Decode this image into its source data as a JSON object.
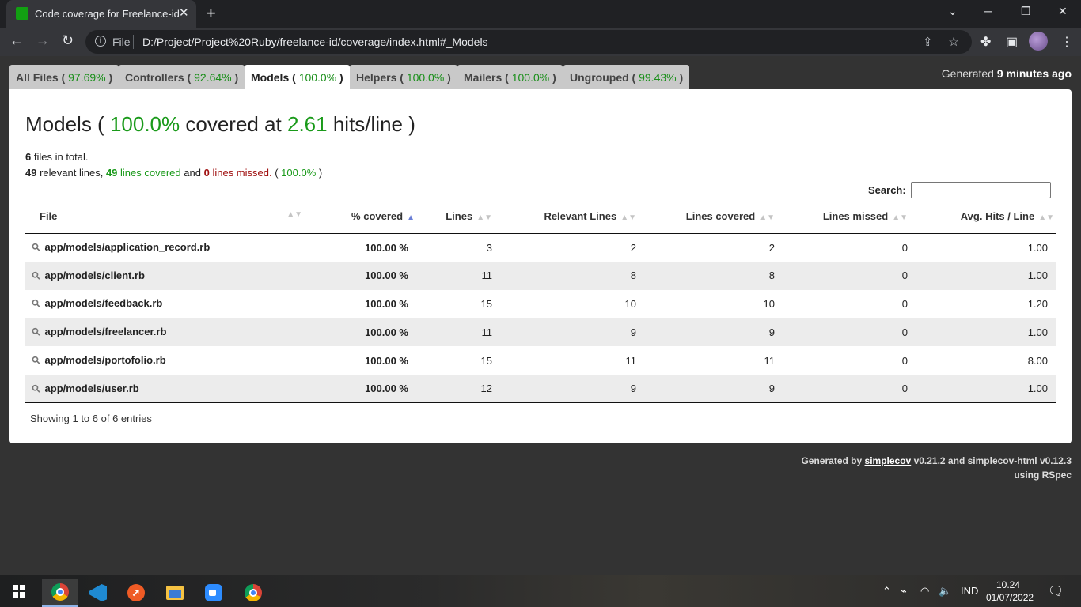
{
  "browser": {
    "tab_title": "Code coverage for Freelance-id",
    "new_tab": "+",
    "url_scheme": "File",
    "url": "D:/Project/Project%20Ruby/freelance-id/coverage/index.html#_Models"
  },
  "coverage_tabs": [
    {
      "name": "All Files",
      "pct": "97.69%"
    },
    {
      "name": "Controllers",
      "pct": "92.64%"
    },
    {
      "name": "Models",
      "pct": "100.0%"
    },
    {
      "name": "Helpers",
      "pct": "100.0%"
    },
    {
      "name": "Mailers",
      "pct": "100.0%"
    },
    {
      "name": "Ungrouped",
      "pct": "99.43%"
    }
  ],
  "generated_top": {
    "prefix": "Generated",
    "time": "9 minutes ago"
  },
  "heading": {
    "title": "Models",
    "covered_pct": "100.0%",
    "covered_word": "covered at",
    "hits": "2.61",
    "hits_word": "hits/line"
  },
  "summary": {
    "files_total": "6",
    "files_text": "files in total.",
    "relevant": "49",
    "relevant_text": "relevant lines,",
    "covered": "49",
    "covered_text": "lines covered",
    "and_text": "and",
    "missed": "0",
    "missed_text": "lines missed.",
    "pct": "100.0%"
  },
  "search_label": "Search:",
  "table": {
    "headers": [
      "File",
      "% covered",
      "Lines",
      "Relevant Lines",
      "Lines covered",
      "Lines missed",
      "Avg. Hits / Line"
    ],
    "rows": [
      {
        "file": "app/models/application_record.rb",
        "pct": "100.00 %",
        "lines": "3",
        "relevant": "2",
        "covered": "2",
        "missed": "0",
        "avg": "1.00"
      },
      {
        "file": "app/models/client.rb",
        "pct": "100.00 %",
        "lines": "11",
        "relevant": "8",
        "covered": "8",
        "missed": "0",
        "avg": "1.00"
      },
      {
        "file": "app/models/feedback.rb",
        "pct": "100.00 %",
        "lines": "15",
        "relevant": "10",
        "covered": "10",
        "missed": "0",
        "avg": "1.20"
      },
      {
        "file": "app/models/freelancer.rb",
        "pct": "100.00 %",
        "lines": "11",
        "relevant": "9",
        "covered": "9",
        "missed": "0",
        "avg": "1.00"
      },
      {
        "file": "app/models/portofolio.rb",
        "pct": "100.00 %",
        "lines": "15",
        "relevant": "11",
        "covered": "11",
        "missed": "0",
        "avg": "8.00"
      },
      {
        "file": "app/models/user.rb",
        "pct": "100.00 %",
        "lines": "12",
        "relevant": "9",
        "covered": "9",
        "missed": "0",
        "avg": "1.00"
      }
    ],
    "footer": "Showing 1 to 6 of 6 entries"
  },
  "generated_bottom": {
    "prefix": "Generated by",
    "link": "simplecov",
    "rest": "v0.21.2 and simplecov-html v0.12.3",
    "line2": "using RSpec"
  },
  "taskbar": {
    "lang": "IND",
    "time": "10.24",
    "date": "01/07/2022"
  },
  "colors": {
    "covered_green": "#1a9a1a",
    "missed_red": "#a01010",
    "page_bg": "#333333"
  }
}
